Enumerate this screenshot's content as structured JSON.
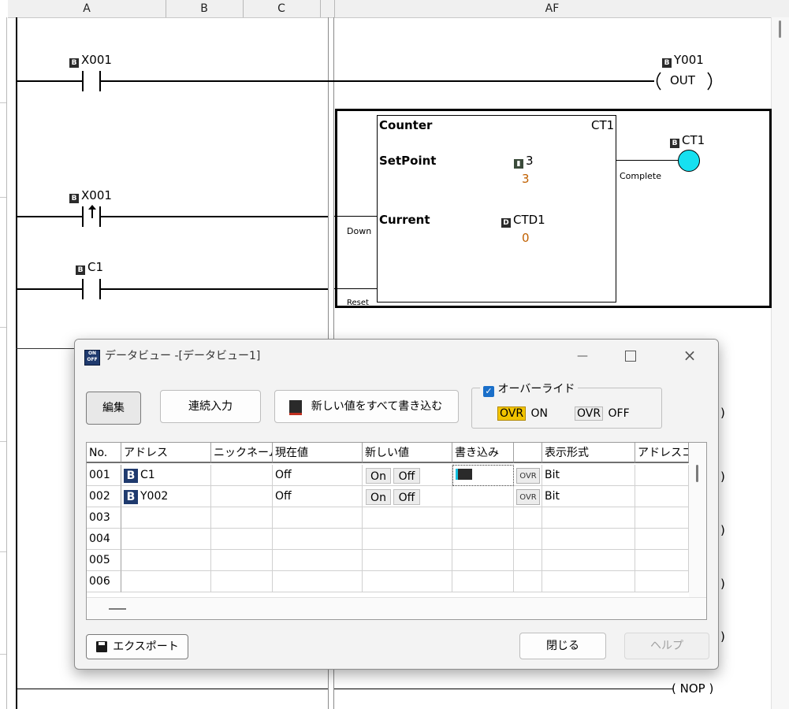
{
  "columns": {
    "a": "A",
    "b": "B",
    "c": "C",
    "af": "AF"
  },
  "ladder": {
    "rung1": {
      "contact_addr": "X001",
      "coil_addr": "Y001",
      "coil_label": "OUT"
    },
    "rung2": {
      "contact_addr": "X001",
      "reset_contact_addr": "C1"
    },
    "counter": {
      "title": "Counter",
      "name": "CT1",
      "setpoint_label": "SetPoint",
      "setpoint_addr": "3",
      "setpoint_value": "3",
      "current_label": "Current",
      "current_addr": "CTD1",
      "current_value": "0",
      "down_label": "Down",
      "reset_label": "Reset",
      "complete_label": "Complete",
      "output_addr": "CT1"
    },
    "nop_label": "NOP",
    "right_paren": ")"
  },
  "dialog": {
    "title": "データビュー -[データビュー1]",
    "edit_label": "編集",
    "continuous_label": "連続入力",
    "write_all_label": "新しい値をすべて書き込む",
    "override_label": "オーバーライド",
    "ovr_tag": "OVR",
    "on_label": "ON",
    "off_label": "OFF",
    "export_label": "エクスポート",
    "close_label": "閉じる",
    "help_label": "ヘルプ",
    "colors": {
      "accent": "#1a6fc9",
      "ovr_on_bg": "#f2c400",
      "coil": "#16e0f0"
    },
    "grid": {
      "headers": [
        "No.",
        "アドレス",
        "ニックネーム",
        "現在値",
        "新しい値",
        "書き込み",
        "",
        "表示形式",
        "アドレスコ"
      ],
      "rows": [
        {
          "no": "001",
          "address": "C1",
          "current": "Off",
          "on": "On",
          "off": "Off",
          "ovr": "OVR",
          "format": "Bit"
        },
        {
          "no": "002",
          "address": "Y002",
          "current": "Off",
          "on": "On",
          "off": "Off",
          "ovr": "OVR",
          "format": "Bit"
        },
        {
          "no": "003"
        },
        {
          "no": "004"
        },
        {
          "no": "005"
        },
        {
          "no": "006"
        }
      ]
    }
  }
}
